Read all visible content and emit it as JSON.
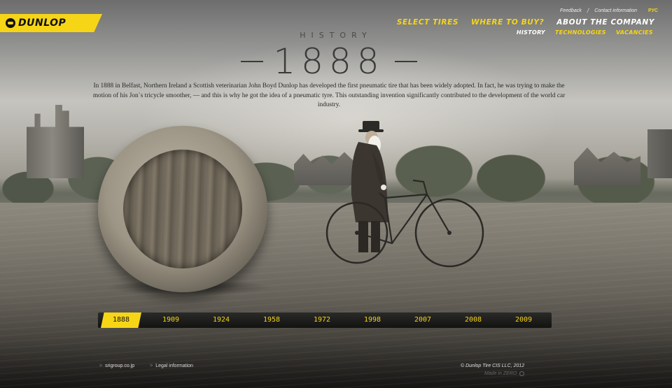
{
  "header": {
    "logo_text": "DUNLOP",
    "utility_links": [
      "Feedback",
      "Contact information"
    ],
    "utility_separator": "/",
    "language": "РУС",
    "nav": [
      {
        "label": "SELECT TIRES",
        "active": false
      },
      {
        "label": "WHERE TO BUY?",
        "active": false
      },
      {
        "label": "ABOUT THE COMPANY",
        "active": true
      }
    ],
    "subnav": [
      {
        "label": "HISTORY",
        "active": true
      },
      {
        "label": "TECHNOLOGIES",
        "active": false
      },
      {
        "label": "VACANCIES",
        "active": false
      }
    ]
  },
  "main": {
    "section_label": "HISTORY",
    "year": "1888",
    "description": "In 1888 in Belfast, Northern Ireland a Scottish veterinarian John Boyd Dunlop has developed the first pneumatic tire that has been widely adopted. In fact, he was trying to make the motion of his Jon`s tricycle smoother, — and this is why he got the idea of a pneumatic tyre. This outstanding invention significantly contributed to the development of the world car industry."
  },
  "timeline": {
    "years": [
      "1888",
      "1909",
      "1924",
      "1958",
      "1972",
      "1998",
      "2007",
      "2008",
      "2009"
    ],
    "active": "1888"
  },
  "footer": {
    "links": [
      "srigroup.co.jp",
      "Legal information"
    ],
    "copyright": "© Dunlop Tire CIS LLC, 2012",
    "made_in": "Made in ZERO"
  },
  "colors": {
    "accent_yellow": "#f6d517",
    "dark": "#111111"
  }
}
